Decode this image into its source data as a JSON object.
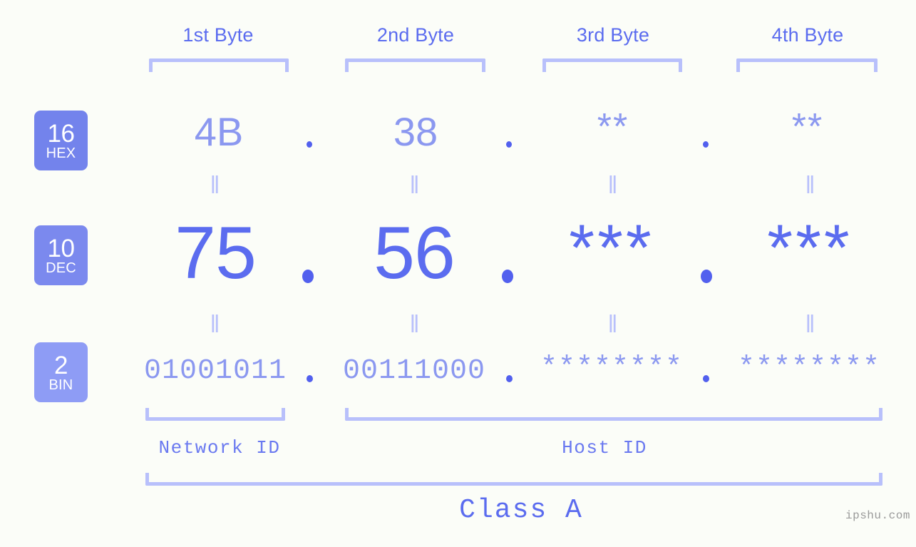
{
  "theme": {
    "background": "#fbfdf8",
    "accent": "#5b6cef",
    "accent_light": "#8b98f0",
    "bracket": "#b8c0fb",
    "badge_hex": "#7383ec",
    "badge_dec": "#7b89ee",
    "badge_bin": "#8e9cf5",
    "watermark_color": "#9a9a9a"
  },
  "header": {
    "bytes": [
      {
        "label": "1st Byte"
      },
      {
        "label": "2nd Byte"
      },
      {
        "label": "3rd Byte"
      },
      {
        "label": "4th Byte"
      }
    ]
  },
  "rows": {
    "hex": {
      "badge_number": "16",
      "badge_name": "HEX",
      "values": [
        "4B",
        "38",
        "**",
        "**"
      ],
      "separators": [
        ".",
        ".",
        "."
      ]
    },
    "dec": {
      "badge_number": "10",
      "badge_name": "DEC",
      "values": [
        "75",
        "56",
        "***",
        "***"
      ],
      "separators": [
        ".",
        ".",
        "."
      ]
    },
    "bin": {
      "badge_number": "2",
      "badge_name": "BIN",
      "values": [
        "01001011",
        "00111000",
        "********",
        "********"
      ],
      "separators": [
        ".",
        ".",
        "."
      ]
    }
  },
  "equals": {
    "glyph": "‖",
    "hex_to_dec": [
      "‖",
      "‖",
      "‖",
      "‖"
    ],
    "dec_to_bin": [
      "‖",
      "‖",
      "‖",
      "‖"
    ]
  },
  "footer": {
    "network_id_label": "Network ID",
    "host_id_label": "Host ID",
    "class_label": "Class A",
    "watermark": "ipshu.com"
  }
}
